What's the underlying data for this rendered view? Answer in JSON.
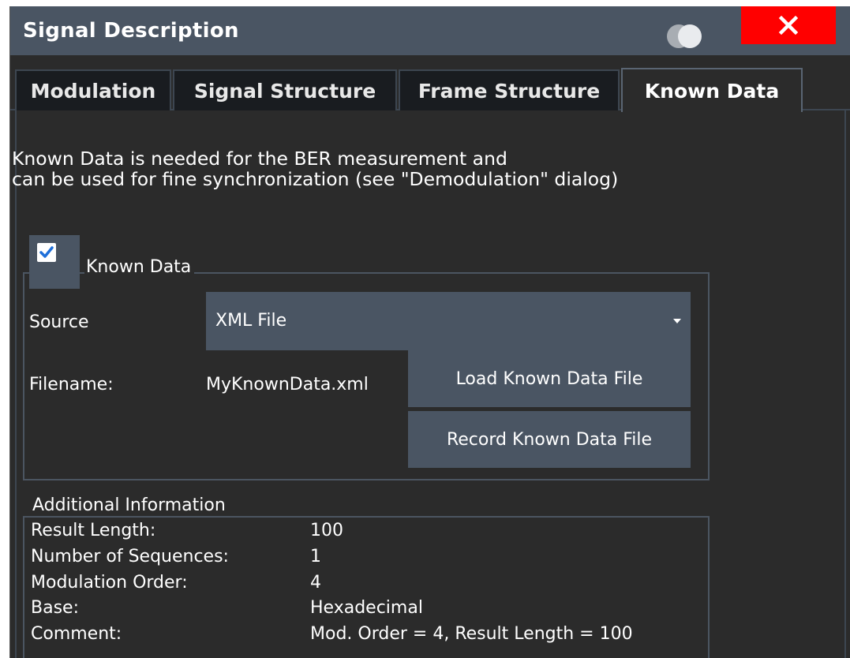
{
  "dialog": {
    "title": "Signal Description",
    "close_icon": "close-icon",
    "toggle_icon": "toggle-icon"
  },
  "tabs": [
    {
      "label": "Modulation",
      "active": false
    },
    {
      "label": "Signal Structure",
      "active": false
    },
    {
      "label": "Frame Structure",
      "active": false
    },
    {
      "label": "Known Data",
      "active": true
    }
  ],
  "known_data": {
    "description_line1": "Known Data is needed for the BER measurement and",
    "description_line2": "can be used for fine synchronization (see \"Demodulation\" dialog)",
    "checkbox_label": "Known Data",
    "checked": true,
    "source_label": "Source",
    "source_value": "XML File",
    "filename_label": "Filename:",
    "filename_value": "MyKnownData.xml",
    "load_button": "Load Known Data File",
    "record_button": "Record Known Data File"
  },
  "additional_info": {
    "section_label": "Additional Information",
    "rows": [
      {
        "key": "Result Length:",
        "value": "100"
      },
      {
        "key": "Number of Sequences:",
        "value": "1"
      },
      {
        "key": "Modulation Order:",
        "value": "4"
      },
      {
        "key": "Base:",
        "value": "Hexadecimal"
      },
      {
        "key": "Comment:",
        "value": "Mod. Order = 4, Result Length = 100"
      }
    ]
  },
  "colors": {
    "titlebar": "#4a5563",
    "background": "#2b2b2b",
    "close": "#ff0000",
    "control": "#4a5563",
    "checkbox_check": "#1e6fd9"
  }
}
